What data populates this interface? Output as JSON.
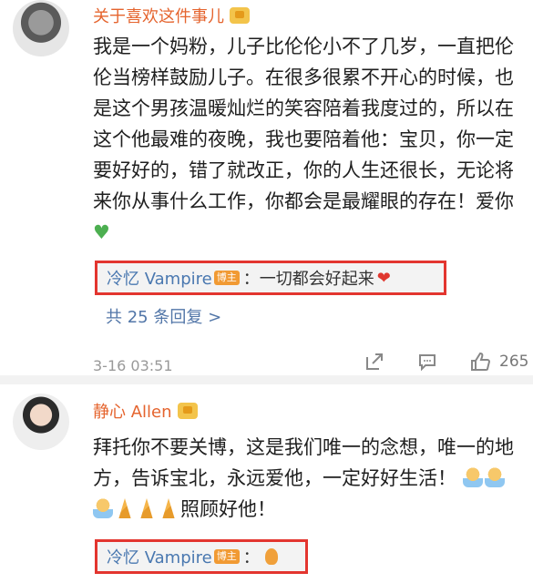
{
  "comments": [
    {
      "username": "关于喜欢这件事儿",
      "text": "我是一个妈粉，儿子比伦伦小不了几岁，一直把伦伦当榜样鼓励儿子。在很多很累不开心的时候，也是这个男孩温暖灿烂的笑容陪着我度过的，所以在这个他最难的夜晚，我也要陪着他：宝贝，你一定要好好的，错了就改正，你的人生还很长，无论将来你从事什么工作，你都会是最耀眼的存在！爱你",
      "reply": {
        "user": "冷忆 Vampire",
        "badge": "博主",
        "text": "：一切都会好起来"
      },
      "more_replies": "共 25 条回复 >",
      "time": "3-16 03:51",
      "likes": "265"
    },
    {
      "username": "静心 Allen",
      "text": "拜托你不要关博，这是我们唯一的念想，唯一的地方，告诉宝北，永远爱他，一定好好生活！",
      "text_suffix": "照顾好他！",
      "reply": {
        "user": "冷忆 Vampire",
        "badge": "博主",
        "text": "："
      }
    }
  ],
  "icons": [
    "share-icon",
    "comment-icon",
    "like-icon",
    "vip-crown-icon",
    "green-heart-icon",
    "red-heart-icon",
    "baby-emoji-icon",
    "pray-emoji-icon",
    "fire-emoji-icon"
  ],
  "colors": {
    "username": "#e5642e",
    "reply_user": "#4a78b0",
    "highlight_border": "#e3352f",
    "badge": "#f19a33"
  }
}
